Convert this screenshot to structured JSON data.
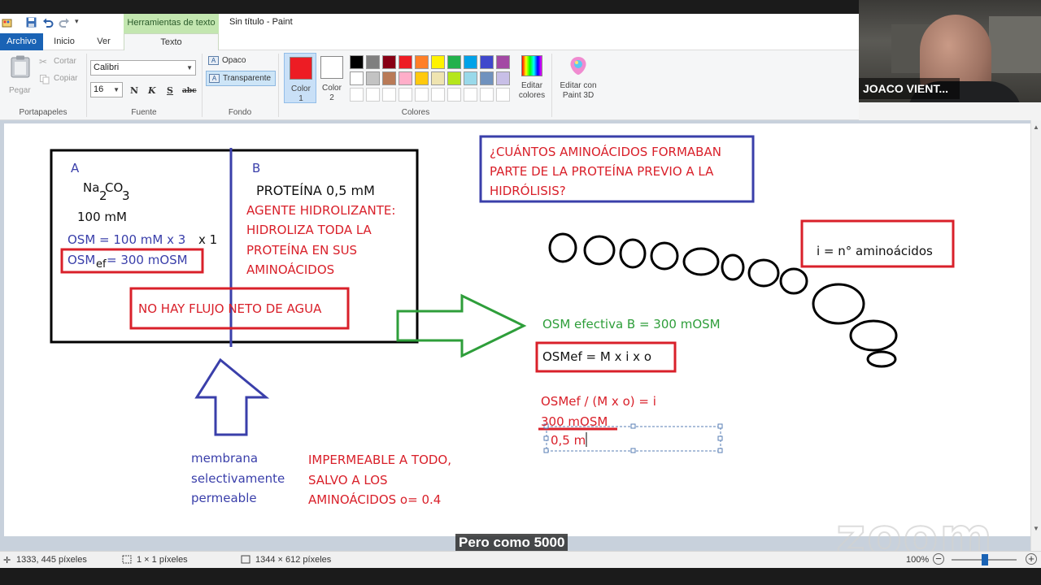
{
  "window": {
    "title": "Sin título - Paint",
    "context_tab": "Herramientas de texto"
  },
  "tabs": {
    "archivo": "Archivo",
    "inicio": "Inicio",
    "ver": "Ver",
    "texto": "Texto"
  },
  "ribbon": {
    "portapapeles": {
      "paste": "Pegar",
      "cut": "Cortar",
      "copy": "Copiar",
      "group": "Portapapeles"
    },
    "fuente": {
      "font_name": "Calibri",
      "font_size": "16",
      "bold": "N",
      "italic": "K",
      "underline": "S",
      "strike": "abc",
      "group": "Fuente"
    },
    "fondo": {
      "opaque": "Opaco",
      "transparent": "Transparente",
      "group": "Fondo"
    },
    "colores": {
      "color1_label": "Color\n1",
      "color1_line1": "Color",
      "color1_line2": "1",
      "color2_line1": "Color",
      "color2_line2": "2",
      "color1_value": "#ed1c24",
      "color2_value": "#ffffff",
      "palette_row1": [
        "#000000",
        "#7f7f7f",
        "#880015",
        "#ed1c24",
        "#ff7f27",
        "#fff200",
        "#22b14c",
        "#00a2e8",
        "#3f48cc",
        "#a349a4"
      ],
      "palette_row2": [
        "#ffffff",
        "#c3c3c3",
        "#b97a57",
        "#ffaec9",
        "#ffc90e",
        "#efe4b0",
        "#b5e61d",
        "#99d9ea",
        "#7092be",
        "#c8bfe7"
      ],
      "edit_line1": "Editar",
      "edit_line2": "colores",
      "group": "Colores"
    },
    "paint3d": {
      "line1": "Editar con",
      "line2": "Paint 3D"
    }
  },
  "webcam": {
    "name": "JOACO VIENT..."
  },
  "canvas": {
    "box_a_label": "A",
    "box_b_label": "B",
    "na": "Na",
    "sub2": "2",
    "co": "CO",
    "sub3": "3",
    "conc_a": "100 mM",
    "osm_a": "OSM = 100 mM x 3",
    "x1": "x 1",
    "osm_ef_prefix": "OSM",
    "osm_ef_sub": "ef",
    "osm_ef_rest": "= 300 mOSM",
    "proteina": "PROTEÍNA 0,5 mM",
    "agente": [
      "AGENTE HIDROLIZANTE:",
      "HIDROLIZA TODA LA",
      "PROTEÍNA EN SUS",
      "AMINOÁCIDOS"
    ],
    "no_flujo": "NO HAY FLUJO NETO DE AGUA",
    "membrana": [
      "membrana",
      "selectivamente",
      "permeable"
    ],
    "impermeable": [
      "IMPERMEABLE A TODO,",
      "SALVO A LOS",
      "AMINOÁCIDOS o= 0.4"
    ],
    "pregunta": [
      "¿CUÁNTOS AMINOÁCIDOS FORMABAN",
      "PARTE DE LA PROTEÍNA PREVIO A LA",
      "HIDRÓLISIS?"
    ],
    "i_def": "i = n° aminoácidos",
    "osm_efectiva_b": "OSM efectiva B = 300 mOSM",
    "formula": "OSMef = M x i x o",
    "despeje": "OSMef / (M x o) = i",
    "numerador": "300 mOSM",
    "denominador": "0,5 m"
  },
  "caption": "Pero como 5000",
  "watermark": "zoom",
  "status": {
    "cursor": "1333, 445 píxeles",
    "selection": "1 × 1 píxeles",
    "canvas_size": "1344 × 612 píxeles",
    "zoom": "100%"
  }
}
